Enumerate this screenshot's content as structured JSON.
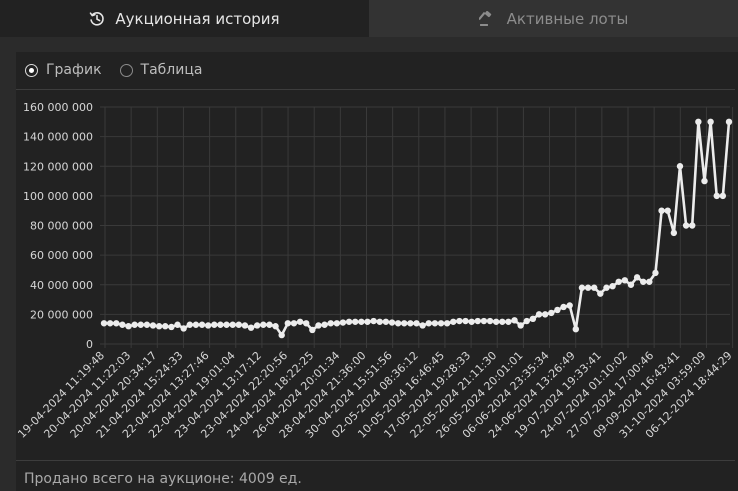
{
  "tabs": [
    {
      "label": "Аукционная история",
      "icon": "history-icon",
      "active": true
    },
    {
      "label": "Активные лоты",
      "icon": "gavel-icon",
      "active": false
    }
  ],
  "view_toggle": [
    {
      "label": "График",
      "checked": true
    },
    {
      "label": "Таблица",
      "checked": false
    }
  ],
  "footer": {
    "text": "Продано всего на аукционе: 4009 ед."
  },
  "colors": {
    "line": "#ececec",
    "grid": "#3a3a3a",
    "text": "#d6d6d6"
  },
  "chart_data": {
    "type": "line",
    "title": "",
    "xlabel": "",
    "ylabel": "",
    "ylim": [
      0,
      160000000
    ],
    "y_ticks": [
      "0",
      "20 000 000",
      "40 000 000",
      "60 000 000",
      "80 000 000",
      "100 000 000",
      "120 000 000",
      "140 000 000",
      "160 000 000"
    ],
    "x_tick_labels": [
      "19-04-2024 11:19:48",
      "20-04-2024 11:22:03",
      "20-04-2024 20:34:17",
      "21-04-2024 15:24:33",
      "22-04-2024 13:27:46",
      "22-04-2024 19:01:04",
      "23-04-2024 13:17:12",
      "23-04-2024 22:20:56",
      "24-04-2024 18:22:25",
      "26-04-2024 20:01:34",
      "28-04-2024 21:36:00",
      "30-04-2024 15:51:56",
      "02-05-2024 08:36:12",
      "10-05-2024 16:46:45",
      "17-05-2024 19:28:33",
      "22-05-2024 21:11:30",
      "26-05-2024 20:01:01",
      "06-06-2024 23:35:34",
      "24-06-2024 13:26:49",
      "19-07-2024 19:33:41",
      "24-07-2024 01:10:02",
      "27-07-2024 17:00:46",
      "09-09-2024 16:43:41",
      "31-10-2024 03:59:09",
      "06-12-2024 18:44:29"
    ],
    "series": [
      {
        "values": [
          14000000,
          14000000,
          14000000,
          13000000,
          12000000,
          13000000,
          13000000,
          13000000,
          12500000,
          12000000,
          12000000,
          11500000,
          13000000,
          10500000,
          13000000,
          13000000,
          13000000,
          12500000,
          13000000,
          13000000,
          13000000,
          13000000,
          13000000,
          12500000,
          11000000,
          12500000,
          13000000,
          13000000,
          12000000,
          6000000,
          14000000,
          14000000,
          15000000,
          14000000,
          9500000,
          12500000,
          13000000,
          14000000,
          14000000,
          14500000,
          15000000,
          15000000,
          15000000,
          15000000,
          15500000,
          15000000,
          15000000,
          14500000,
          14000000,
          14000000,
          14000000,
          14000000,
          12500000,
          14000000,
          14000000,
          14000000,
          14000000,
          15000000,
          15500000,
          15500000,
          15000000,
          15500000,
          15500000,
          15500000,
          15000000,
          15000000,
          15000000,
          16000000,
          12500000,
          15500000,
          17000000,
          20000000,
          20000000,
          21000000,
          23000000,
          25000000,
          26000000,
          10000000,
          38000000,
          38000000,
          38000000,
          34000000,
          38000000,
          39000000,
          42000000,
          43000000,
          40000000,
          45000000,
          42000000,
          42000000,
          48000000,
          90000000,
          90000000,
          75000000,
          120000000,
          80000000,
          80000000,
          150000000,
          110000000,
          150000000,
          100000000,
          100000000,
          150000000
        ]
      }
    ]
  }
}
